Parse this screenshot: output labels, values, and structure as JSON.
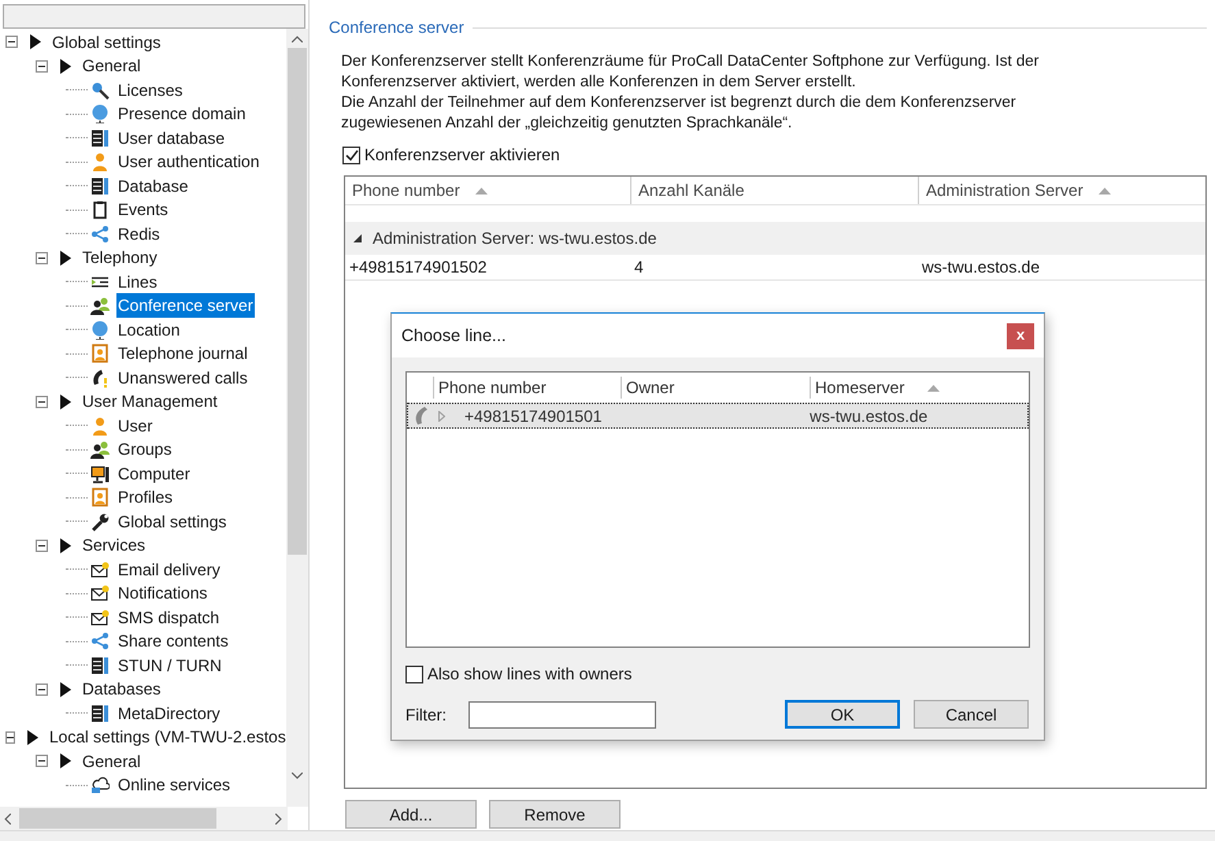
{
  "tree": {
    "items": [
      {
        "label": "Global settings",
        "expanded": true,
        "selected": false,
        "children": [
          {
            "label": "General",
            "expanded": true,
            "selected": false,
            "children": [
              {
                "label": "Licenses",
                "selected": false
              },
              {
                "label": "Presence domain",
                "selected": false
              },
              {
                "label": "User database",
                "selected": false
              },
              {
                "label": "User authentication",
                "selected": false
              },
              {
                "label": "Database",
                "selected": false
              },
              {
                "label": "Events",
                "selected": false
              },
              {
                "label": "Redis",
                "selected": false
              }
            ]
          },
          {
            "label": "Telephony",
            "expanded": true,
            "selected": false,
            "children": [
              {
                "label": "Lines",
                "selected": false
              },
              {
                "label": "Conference server",
                "selected": true
              },
              {
                "label": "Location",
                "selected": false
              },
              {
                "label": "Telephone journal",
                "selected": false
              },
              {
                "label": "Unanswered calls",
                "selected": false
              }
            ]
          },
          {
            "label": "User Management",
            "expanded": true,
            "selected": false,
            "children": [
              {
                "label": "User",
                "selected": false
              },
              {
                "label": "Groups",
                "selected": false
              },
              {
                "label": "Computer",
                "selected": false
              },
              {
                "label": "Profiles",
                "selected": false
              },
              {
                "label": "Global settings",
                "selected": false
              }
            ]
          },
          {
            "label": "Services",
            "expanded": true,
            "selected": false,
            "children": [
              {
                "label": "Email delivery",
                "selected": false
              },
              {
                "label": "Notifications",
                "selected": false
              },
              {
                "label": "SMS dispatch",
                "selected": false
              },
              {
                "label": "Share contents",
                "selected": false
              },
              {
                "label": "STUN / TURN",
                "selected": false
              }
            ]
          },
          {
            "label": "Databases",
            "expanded": true,
            "selected": false,
            "children": [
              {
                "label": "MetaDirectory",
                "selected": false
              }
            ]
          }
        ]
      },
      {
        "label": "Local settings (VM-TWU-2.estos",
        "expanded": true,
        "selected": false,
        "children": [
          {
            "label": "General",
            "expanded": true,
            "selected": false,
            "children": [
              {
                "label": "Online services",
                "selected": false
              }
            ]
          }
        ]
      }
    ]
  },
  "panel": {
    "title": "Conference server",
    "description": [
      "Der Konferenzserver stellt Konferenzräume für ProCall DataCenter Softphone zur Verfügung. Ist der Konferenzserver aktiviert, werden alle Konferenzen in dem Server erstellt.",
      "Die Anzahl der Teilnehmer auf dem Konferenzserver ist begrenzt durch die dem Konferenzserver zugewiesenen Anzahl der „gleichzeitig genutzten Sprachkanäle“."
    ],
    "activate": {
      "label": "Konferenzserver aktivieren",
      "checked": true
    },
    "table": {
      "columns": [
        {
          "label": "Phone number",
          "sorted": true
        },
        {
          "label": "Anzahl Kanäle",
          "sorted": false
        },
        {
          "label": "Administration Server",
          "sorted": true
        }
      ],
      "groups": [
        {
          "label": "Administration Server: ws-twu.estos.de",
          "expanded": true,
          "rows": [
            [
              "+49815174901502",
              "4",
              "ws-twu.estos.de"
            ]
          ]
        }
      ]
    },
    "buttons": [
      "Add...",
      "Remove"
    ]
  },
  "dialog": {
    "title": "Choose line...",
    "close": "x",
    "columns": [
      {
        "label": "Phone number",
        "sorted": false
      },
      {
        "label": "Owner",
        "sorted": false
      },
      {
        "label": "Homeserver",
        "sorted": true
      }
    ],
    "rows": [
      {
        "cells": [
          "+49815174901501",
          "",
          "ws-twu.estos.de"
        ],
        "selected": true
      }
    ],
    "show_owners": {
      "label": "Also show lines with owners",
      "checked": false
    },
    "filter": {
      "label": "Filter:"
    },
    "buttons": [
      {
        "label": "OK",
        "default": true
      },
      {
        "label": "Cancel",
        "default": false
      }
    ]
  }
}
